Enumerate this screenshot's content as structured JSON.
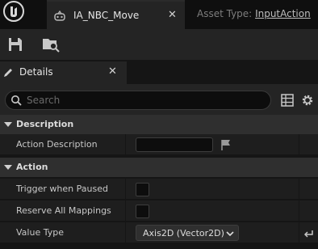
{
  "tab": {
    "title": "IA_NBC_Move"
  },
  "asset_type": {
    "label": "Asset Type:",
    "value": "InputAction"
  },
  "details": {
    "tab_label": "Details"
  },
  "search": {
    "placeholder": "Search"
  },
  "sections": [
    {
      "title": "Description",
      "properties": [
        {
          "name": "Action Description",
          "value": ""
        }
      ]
    },
    {
      "title": "Action",
      "properties": [
        {
          "name": "Trigger when Paused",
          "checked": false
        },
        {
          "name": "Reserve All Mappings",
          "checked": false
        },
        {
          "name": "Value Type",
          "value": "Axis2D (Vector2D)"
        }
      ]
    }
  ],
  "icons": [
    "unreal-logo-icon",
    "input-action-icon",
    "close-icon",
    "save-icon",
    "browse-icon",
    "pencil-icon",
    "search-icon",
    "grid-view-icon",
    "gear-icon",
    "flag-icon",
    "chevron-down-icon",
    "reset-arrow-icon"
  ]
}
